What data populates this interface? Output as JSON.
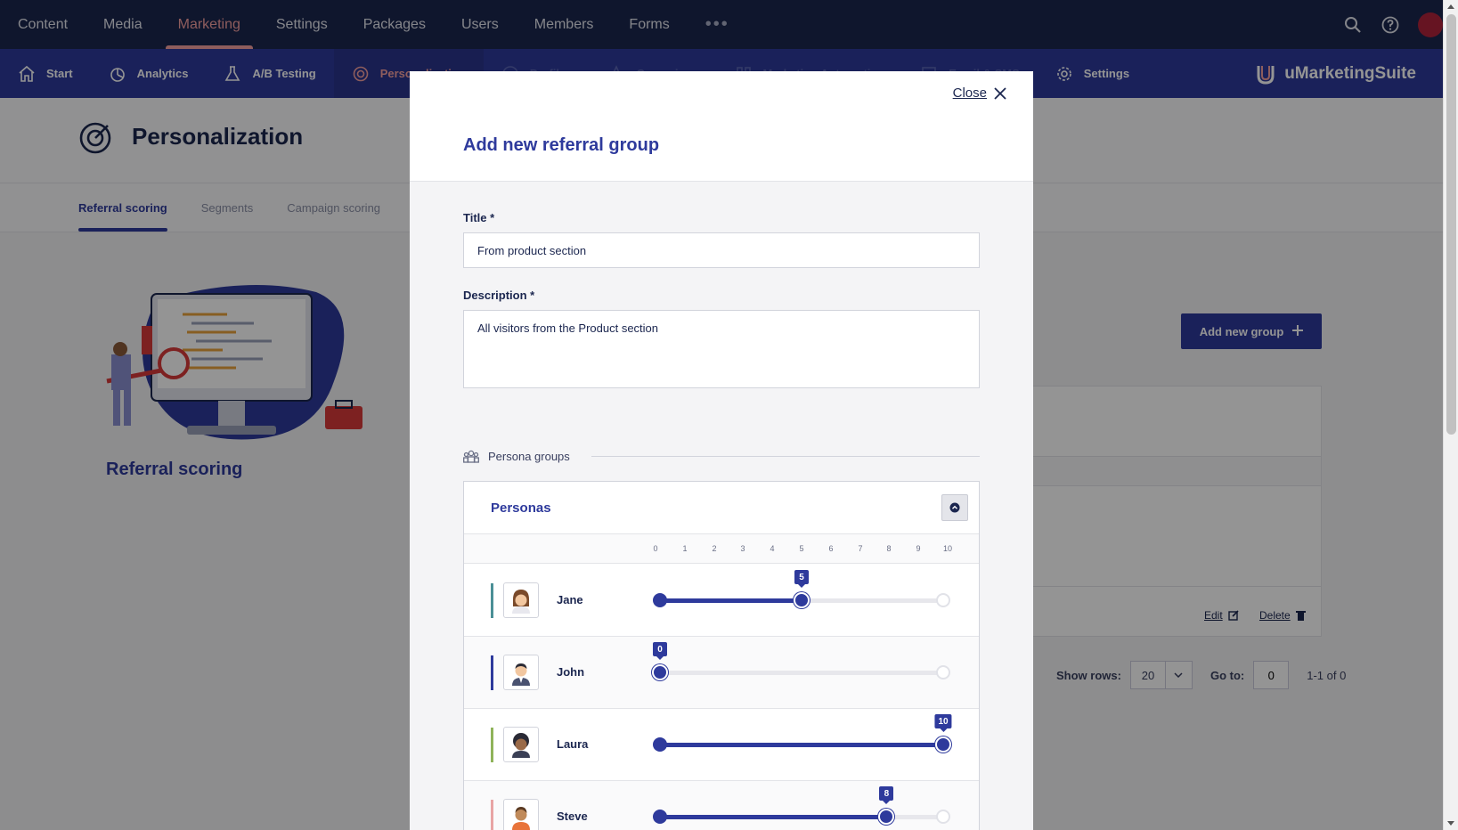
{
  "topnav": {
    "items": [
      "Content",
      "Media",
      "Marketing",
      "Settings",
      "Packages",
      "Users",
      "Members",
      "Forms"
    ],
    "active": "Marketing",
    "more": "•••"
  },
  "subnav": {
    "items": [
      {
        "label": "Start",
        "icon": "home-icon"
      },
      {
        "label": "Analytics",
        "icon": "pie-chart-icon"
      },
      {
        "label": "A/B Testing",
        "icon": "flask-icon"
      },
      {
        "label": "Personalization",
        "icon": "target-icon"
      },
      {
        "label": "Profiles",
        "icon": "profile-icon"
      },
      {
        "label": "Campaigns",
        "icon": "campaign-icon"
      },
      {
        "label": "Marketing Automation",
        "icon": "automation-icon"
      },
      {
        "label": "Email & SMS",
        "icon": "email-icon"
      },
      {
        "label": "Settings",
        "icon": "gear-icon"
      }
    ],
    "brand": "uMarketingSuite"
  },
  "page": {
    "title": "Personalization",
    "tabs": [
      "Referral scoring",
      "Segments",
      "Campaign scoring"
    ],
    "illustration_title": "Referral scoring",
    "add_button": "Add new group",
    "row_actions": {
      "edit": "Edit",
      "delete": "Delete"
    },
    "pager": {
      "show_rows_label": "Show rows:",
      "rows": "20",
      "goto_label": "Go to:",
      "goto_value": "0",
      "range": "1-1 of 0"
    }
  },
  "modal": {
    "title": "Add new referral group",
    "close_label": "Close",
    "title_label": "Title *",
    "title_value": "From product section",
    "description_label": "Description *",
    "description_value": "All visitors from the Product section",
    "persona_groups_label": "Persona groups",
    "personas_title": "Personas",
    "scale": [
      "0",
      "1",
      "2",
      "3",
      "4",
      "5",
      "6",
      "7",
      "8",
      "9",
      "10"
    ],
    "personas": [
      {
        "name": "Jane",
        "score": 5,
        "color": "#4a8f96"
      },
      {
        "name": "John",
        "score": 0,
        "color": "#2e3a9c"
      },
      {
        "name": "Laura",
        "score": 10,
        "color": "#8fb35a"
      },
      {
        "name": "Steve",
        "score": 8,
        "color": "#e8a4a4"
      }
    ]
  },
  "colors": {
    "primary": "#2e3a9c",
    "navy": "#1b264f",
    "accent": "#f5a0a0"
  }
}
